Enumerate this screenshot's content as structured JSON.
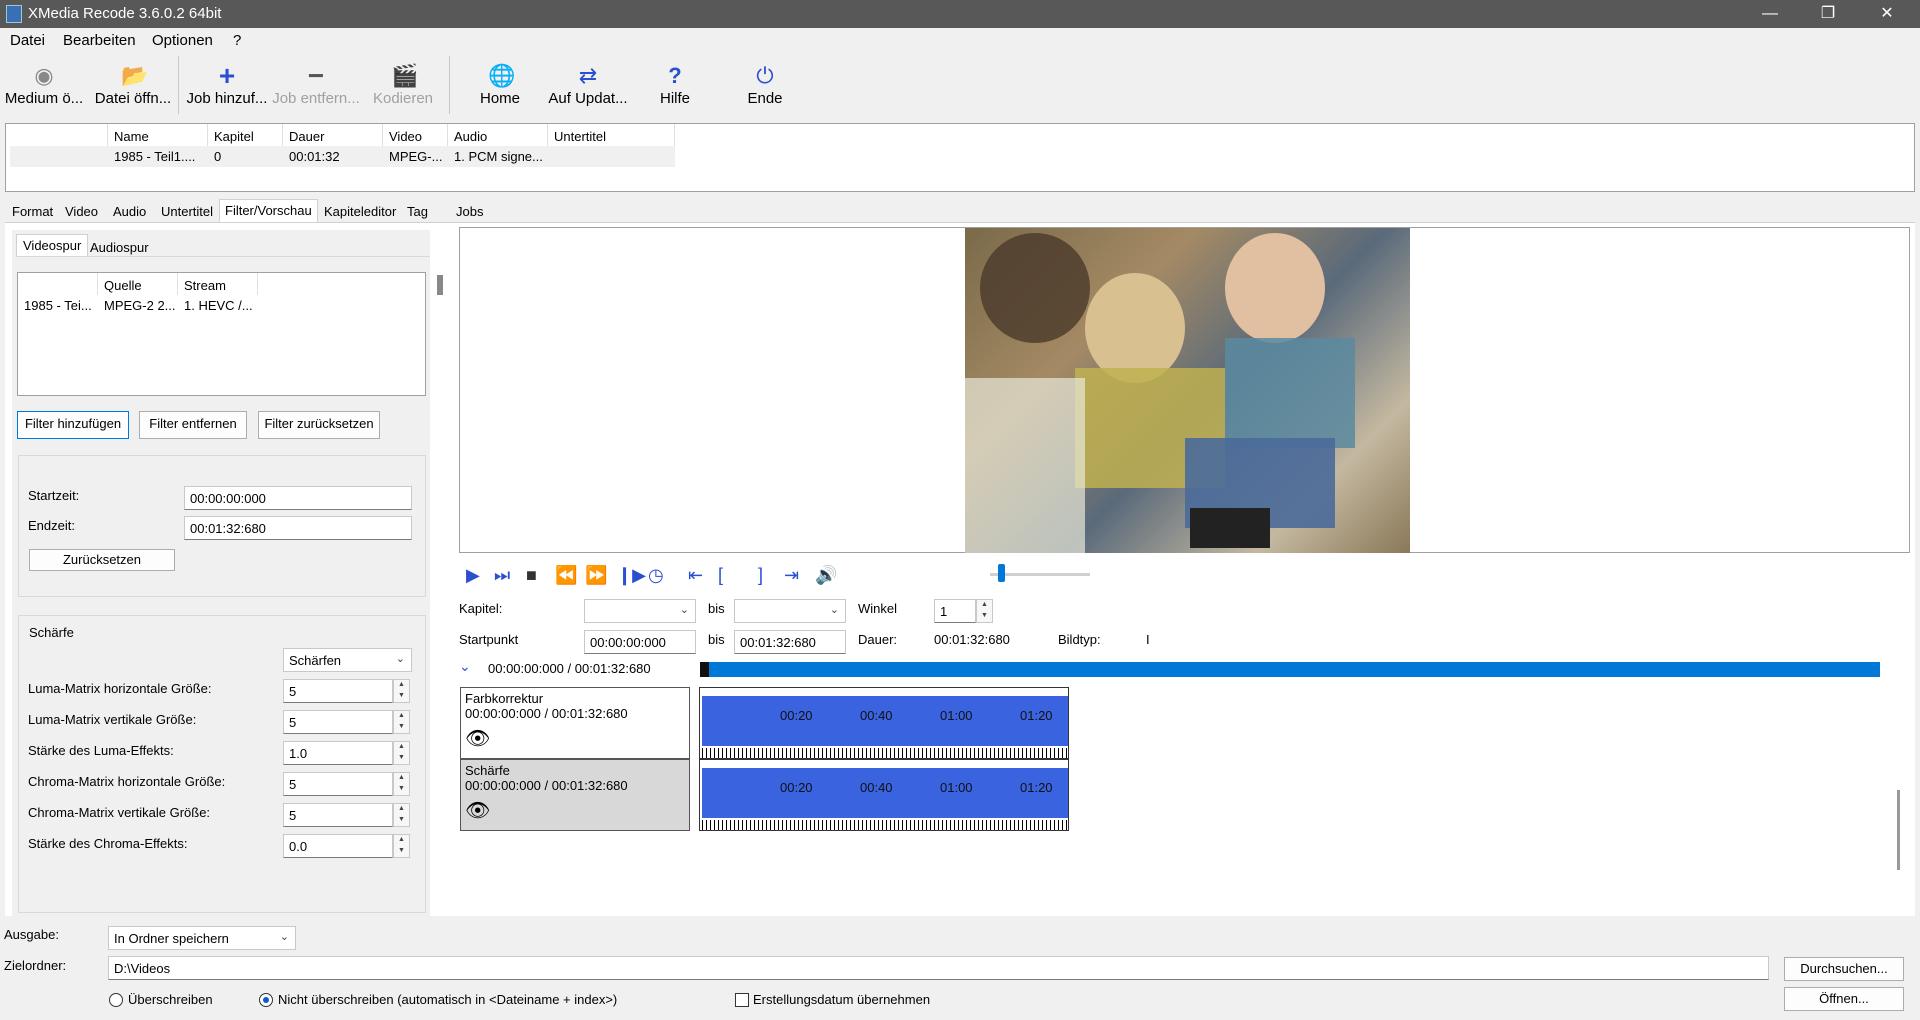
{
  "window": {
    "title": "XMedia Recode 3.6.0.2 64bit"
  },
  "menu": [
    "Datei",
    "Bearbeiten",
    "Optionen",
    "?"
  ],
  "toolbar": {
    "medium": "Medium ö...",
    "datei": "Datei öffn...",
    "job_add": "Job hinzuf...",
    "job_remove": "Job entfern...",
    "encode": "Kodieren",
    "home": "Home",
    "update": "Auf Updat...",
    "help": "Hilfe",
    "end": "Ende"
  },
  "joblist": {
    "headers": [
      "Name",
      "Kapitel",
      "Dauer",
      "Video",
      "Audio",
      "Untertitel"
    ],
    "row": [
      "1985 - Teil1....",
      "0",
      "00:01:32",
      "MPEG-...",
      "1. PCM signe...",
      ""
    ]
  },
  "tabs": [
    "Format",
    "Video",
    "Audio",
    "Untertitel",
    "Filter/Vorschau",
    "Kapiteleditor",
    "Tag",
    "Jobs"
  ],
  "subtabs": [
    "Videospur",
    "Audiospur"
  ],
  "streamlist": {
    "headers": [
      "",
      "Quelle",
      "Stream"
    ],
    "row": [
      "1985 - Tei...",
      "MPEG-2 2...",
      "1. HEVC /..."
    ]
  },
  "filter_buttons": {
    "add": "Filter hinzufügen",
    "remove": "Filter entfernen",
    "reset": "Filter zurücksetzen"
  },
  "timegroup": {
    "start_label": "Startzeit:",
    "start_value": "00:00:00:000",
    "end_label": "Endzeit:",
    "end_value": "00:01:32:680",
    "reset": "Zurücksetzen"
  },
  "sharpness": {
    "title": "Schärfe",
    "mode": "Schärfen",
    "params": [
      {
        "label": "Luma-Matrix horizontale Größe:",
        "value": "5"
      },
      {
        "label": "Luma-Matrix vertikale Größe:",
        "value": "5"
      },
      {
        "label": "Stärke des Luma-Effekts:",
        "value": "1.0"
      },
      {
        "label": "Chroma-Matrix horizontale Größe:",
        "value": "5"
      },
      {
        "label": "Chroma-Matrix vertikale Größe:",
        "value": "5"
      },
      {
        "label": "Stärke des Chroma-Effekts:",
        "value": "0.0"
      }
    ]
  },
  "preview": {
    "kapitel_label": "Kapitel:",
    "bis": "bis",
    "winkel_label": "Winkel",
    "winkel_value": "1",
    "startpunkt_label": "Startpunkt",
    "start_value": "00:00:00:000",
    "end_value": "00:01:32:680",
    "dauer_label": "Dauer:",
    "dauer_value": "00:01:32:680",
    "bildtyp_label": "Bildtyp:",
    "bildtyp_value": "I",
    "position": "00:00:00:000 / 00:01:32:680"
  },
  "tracks": [
    {
      "name": "Farbkorrektur",
      "time": "00:00:00:000 / 00:01:32:680"
    },
    {
      "name": "Schärfe",
      "time": "00:00:00:000 / 00:01:32:680"
    }
  ],
  "track_ticks": [
    "00:20",
    "00:40",
    "01:00",
    "01:20"
  ],
  "output": {
    "ausgabe_label": "Ausgabe:",
    "ausgabe_value": "In Ordner speichern",
    "zielordner_label": "Zielordner:",
    "zielordner_value": "D:\\Videos",
    "browse": "Durchsuchen...",
    "open": "Öffnen...",
    "overwrite": "Überschreiben",
    "no_overwrite": "Nicht überschreiben (automatisch in <Dateiname + index>)",
    "creation_date": "Erstellungsdatum übernehmen"
  }
}
